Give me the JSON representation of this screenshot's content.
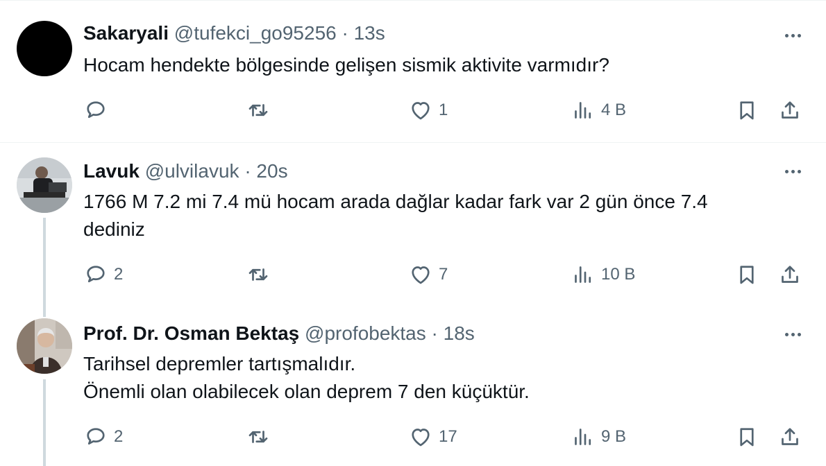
{
  "tweets": [
    {
      "name": "Sakaryali",
      "handle": "@tufekci_go95256",
      "separator": "·",
      "time": "13s",
      "lines": [
        "Hocam hendekte bölgesinde gelişen sismik aktivite varmıdır?"
      ],
      "reply_count": "",
      "retweet_count": "",
      "like_count": "1",
      "view_count": "4 B"
    },
    {
      "name": "Lavuk",
      "handle": "@ulvilavuk",
      "separator": "·",
      "time": "20s",
      "lines": [
        "1766 M 7.2 mi 7.4 mü hocam arada dağlar kadar fark var 2 gün önce 7.4",
        "dediniz"
      ],
      "reply_count": "2",
      "retweet_count": "",
      "like_count": "7",
      "view_count": "10 B"
    },
    {
      "name": "Prof. Dr. Osman Bektaş",
      "handle": "@profobektas",
      "separator": "·",
      "time": "18s",
      "lines": [
        "Tarihsel depremler tartışmalıdır.",
        "Önemli olan olabilecek olan deprem 7 den küçüktür."
      ],
      "reply_count": "2",
      "retweet_count": "",
      "like_count": "17",
      "view_count": "9 B"
    }
  ]
}
